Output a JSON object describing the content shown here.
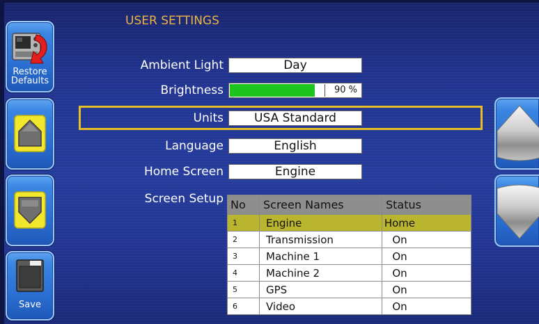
{
  "screen": {
    "title": "USER SETTINGS"
  },
  "left_panel": {
    "restore_button": {
      "label": "Restore Defaults",
      "icon": "restore-defaults-icon"
    },
    "up_button": {
      "icon": "up-arrow-icon"
    },
    "down_button": {
      "icon": "down-arrow-icon"
    },
    "save_button": {
      "label": "Save",
      "icon": "save-icon"
    }
  },
  "right_panel": {
    "scroll_up_button": {
      "icon": "scroll-up-arrow-icon"
    },
    "scroll_down_button": {
      "icon": "scroll-down-arrow-icon"
    }
  },
  "settings": {
    "ambient_light": {
      "label": "Ambient Light",
      "value": "Day"
    },
    "brightness": {
      "label": "Brightness",
      "value_text": "90 %",
      "level_percent": 90
    },
    "units": {
      "label": "Units",
      "value": "USA Standard",
      "selected": true
    },
    "language": {
      "label": "Language",
      "value": "English"
    },
    "home_screen": {
      "label": "Home Screen",
      "value": "Engine"
    },
    "screen_setup": {
      "label": "Screen Setup"
    }
  },
  "screen_table": {
    "headers": {
      "no": "No",
      "name": "Screen Names",
      "status": "Status"
    },
    "rows": [
      {
        "no": "1",
        "name": "Engine",
        "status": "Home",
        "selected": true
      },
      {
        "no": "2",
        "name": "Transmission",
        "status": "On",
        "selected": false
      },
      {
        "no": "3",
        "name": "Machine 1",
        "status": "On",
        "selected": false
      },
      {
        "no": "4",
        "name": "Machine 2",
        "status": "On",
        "selected": false
      },
      {
        "no": "5",
        "name": "GPS",
        "status": "On",
        "selected": false
      },
      {
        "no": "6",
        "name": "Video",
        "status": "On",
        "selected": false
      }
    ]
  },
  "colors": {
    "title": "#efb443",
    "selection_frame": "#e6c024",
    "selected_row": "#b9b52f",
    "brightness_fill": "#1ec41e",
    "table_header": "#8e8e8e",
    "arrow_pad": "#f2e72c"
  }
}
